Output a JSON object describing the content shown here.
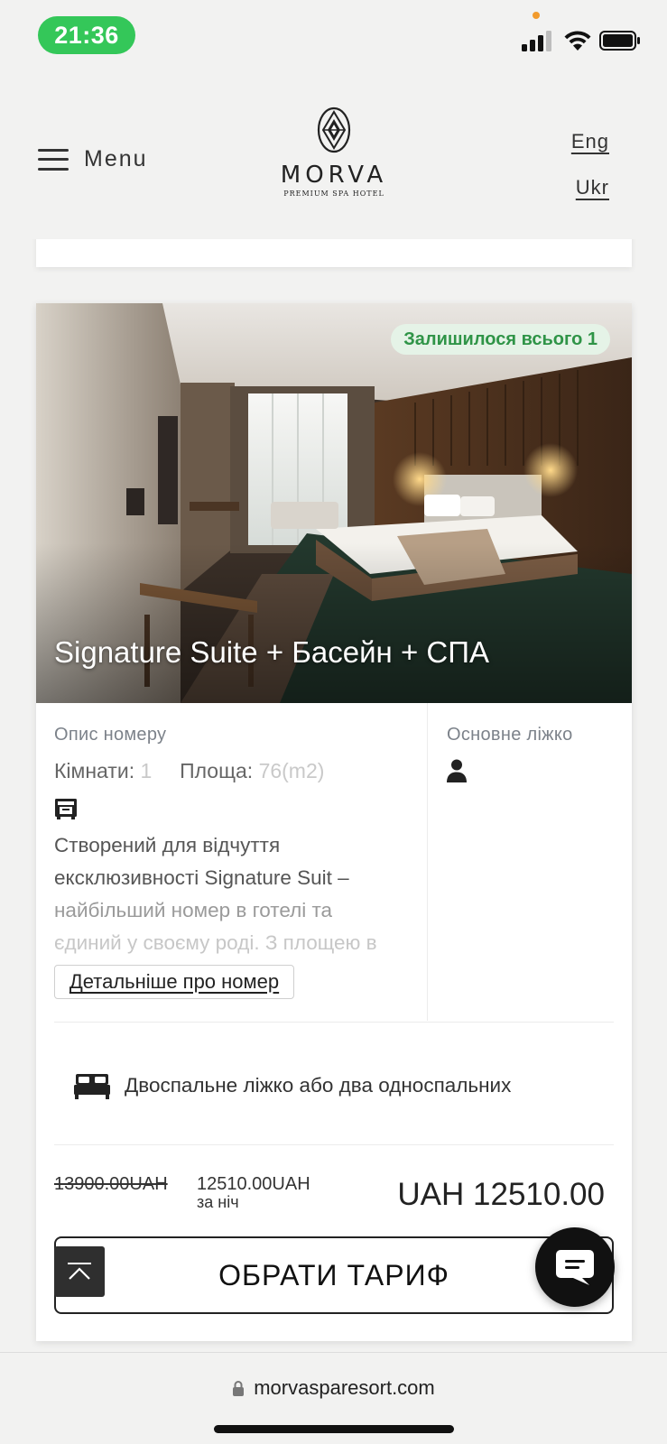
{
  "status_bar": {
    "time": "21:36",
    "icons": [
      "signal-icon",
      "wifi-icon",
      "battery-icon"
    ]
  },
  "header": {
    "menu_label": "Menu",
    "logo_name": "MORVA",
    "logo_tagline": "PREMIUM SPA HOTEL",
    "languages": [
      "Eng",
      "Ukr"
    ]
  },
  "room": {
    "availability": "Залишилося всього 1",
    "title": "Signature Suite + Басейн + СПА",
    "description_label": "Опис номеру",
    "rooms_label": "Кімнати:",
    "rooms_value": "1",
    "area_label": "Площа:",
    "area_value": "76(m2)",
    "description_lines": [
      "Створений для відчуття",
      "ексклюзивності Signature Suit –",
      "найбільший номер в готелі та",
      "єдиний у своєму роді. З площею в"
    ],
    "details_button": "Детальніше про номер",
    "main_bed_label": "Основне ліжко",
    "bed_type": "Двоспальне ліжко або два односпальних",
    "price_old": "13900.00UAH",
    "price_new": "12510.00UAH",
    "per_night": "за ніч",
    "price_total": "UAH 12510.00",
    "choose_button": "ОБРАТИ ТАРИФ"
  },
  "browser": {
    "url": "morvasparesort.com"
  },
  "colors": {
    "status_pill": "#34c759",
    "badge_bg": "#e5f3e7",
    "badge_text": "#2f9447",
    "page_bg": "#f2f2f1"
  }
}
